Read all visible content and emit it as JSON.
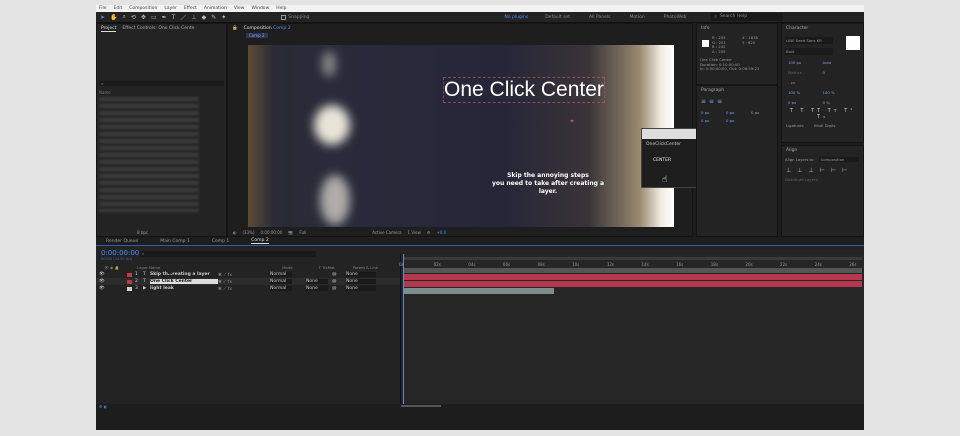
{
  "menu": [
    "File",
    "Edit",
    "Composition",
    "Layer",
    "Effect",
    "Animation",
    "View",
    "Window",
    "Help"
  ],
  "toolbar": {
    "snapping": "Snapping"
  },
  "workspaces": [
    "No plugins",
    "Default set",
    "All Panels",
    "Motion",
    "PhotoWeb"
  ],
  "search_help": "Search Help",
  "project_panel": {
    "tab": "Project",
    "effect_tab": "Effect Controls: One Click Cente",
    "name_col": "Name",
    "bpc": "8 bpc"
  },
  "composition_panel": {
    "tab": "Composition",
    "comp_name": "Comp 2",
    "breadcrumb": "Comp 2",
    "zoom": "(33%)",
    "timecode": "0:00:00:00",
    "resolution": "Full",
    "camera": "Active Camera",
    "views": "1 View",
    "offset": "+0.0"
  },
  "canvas": {
    "title": "One Click Center",
    "subtitle_line1": "Skip the annoying steps",
    "subtitle_line2": "you need to take after creating a layer."
  },
  "plugin_popup": {
    "title": "OneClickCenter",
    "button": "CENTER"
  },
  "info": {
    "tab": "Info",
    "r": "R : 255",
    "g": "G : 251",
    "b": "B : 242",
    "a": "A : 255",
    "x": "X : 1838",
    "y": "Y : 620",
    "layer": "One Click Center",
    "duration": "Duration: 0:10:00:00",
    "inout": "In: 0:00:00:00, Out: 0:09:59:23"
  },
  "paragraph": {
    "tab": "Paragraph",
    "values": [
      "0 px",
      "0 px",
      "0 px",
      "0 px",
      "0 px"
    ]
  },
  "character": {
    "tab": "Character",
    "font": "LINE Seed Sans KR",
    "style": "Bold",
    "size": "100 px",
    "leading": "Auto",
    "tracking": "0",
    "kerning": "Metrics",
    "stroke": "- px",
    "vscale": "100 %",
    "hscale": "100 %",
    "baseline": "0 px",
    "tsume": "0 %",
    "ligatures": "Ligatures",
    "hindi": "Hindi Digits"
  },
  "align": {
    "tab": "Align",
    "align_to_label": "Align Layers to:",
    "align_to": "Composition",
    "distribute": "Distribute Layers:"
  },
  "timeline": {
    "tabs": [
      "Render Queue",
      "Main Comp 1",
      "Comp 1",
      "Comp 2"
    ],
    "active_tab": 3,
    "timecode": "0:00:00:00",
    "timecode_sub": "00000 (24.00 fps)",
    "headers": {
      "layer_name": "Layer Name",
      "mode": "Mode",
      "trkmat": "T TrkMat",
      "parent": "Parent & Link"
    },
    "layers": [
      {
        "num": "1",
        "type": "T",
        "name": "Skip th…reating a layer",
        "mode": "Normal",
        "trkmat": "",
        "parent": "None",
        "color": "#c0384a"
      },
      {
        "num": "2",
        "type": "T",
        "name": "One Click Center",
        "mode": "Normal",
        "trkmat": "None",
        "parent": "None",
        "color": "#c0384a"
      },
      {
        "num": "3",
        "type": "▶",
        "name": "light leak",
        "mode": "Normal",
        "trkmat": "None",
        "parent": "None",
        "color": "#d0d0d0"
      }
    ],
    "ticks": [
      "0s",
      "02s",
      "04s",
      "06s",
      "08s",
      "10s",
      "12s",
      "14s",
      "16s",
      "18s",
      "20s",
      "22s",
      "24s",
      "26s"
    ],
    "bar_colors": {
      "text": "#b5384c",
      "footage": "#7d8d8c"
    },
    "footage_end_seconds": 8.7,
    "total_seconds": 26.5
  }
}
